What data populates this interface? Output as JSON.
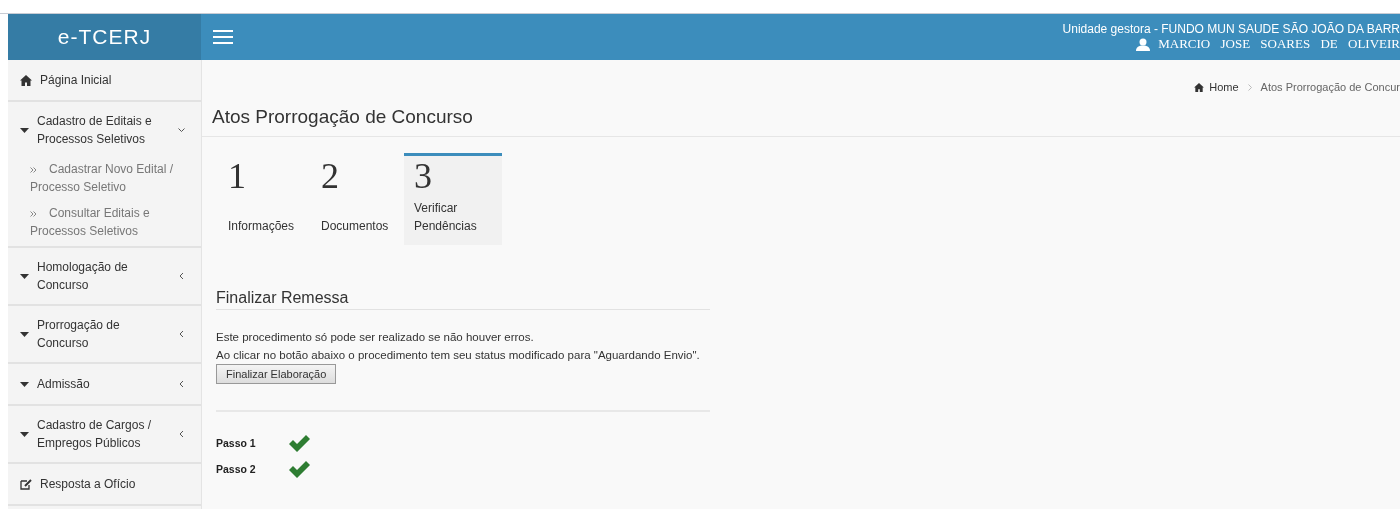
{
  "header": {
    "logo": "e-TCERJ",
    "unit": "Unidade gestora - FUNDO MUN SAUDE SÃO JOÃO DA BARR",
    "user": "MARCIO JOSE SOARES DE OLIVEIR"
  },
  "sidebar": {
    "items": [
      {
        "kind": "home",
        "label": "Página Inicial"
      },
      {
        "kind": "group",
        "label": "Cadastro de Editais e Processos Seletivos",
        "expanded": true,
        "children": [
          {
            "label": "Cadastrar Novo Edital / Processo Seletivo"
          },
          {
            "label": "Consultar Editais e Processos Seletivos"
          }
        ]
      },
      {
        "kind": "group",
        "label": "Homologação de Concurso",
        "expanded": false
      },
      {
        "kind": "group",
        "label": "Prorrogação de Concurso",
        "expanded": false
      },
      {
        "kind": "group",
        "label": "Admissão",
        "expanded": false
      },
      {
        "kind": "group",
        "label": "Cadastro de Cargos / Empregos Públicos",
        "expanded": false
      },
      {
        "kind": "edit",
        "label": "Resposta a Ofício"
      }
    ]
  },
  "breadcrumb": [
    "Home",
    "Atos Prorrogação de Concur"
  ],
  "page_title": "Atos Prorrogação de Concurso",
  "steps": [
    {
      "number": "1",
      "label": "Informações",
      "selected": false
    },
    {
      "number": "2",
      "label": "Documentos",
      "selected": false
    },
    {
      "number": "3",
      "label": "Verificar Pendências",
      "selected": true
    }
  ],
  "section": {
    "title": "Finalizar Remessa",
    "lines": [
      "Este procedimento só pode ser realizado se não houver erros.",
      "Ao clicar no botão abaixo o procedimento tem seu status modificado para \"Aguardando Envio\"."
    ],
    "button": "Finalizar Elaboração"
  },
  "checks": [
    {
      "label": "Passo 1",
      "done": true
    },
    {
      "label": "Passo 2",
      "done": true
    }
  ]
}
